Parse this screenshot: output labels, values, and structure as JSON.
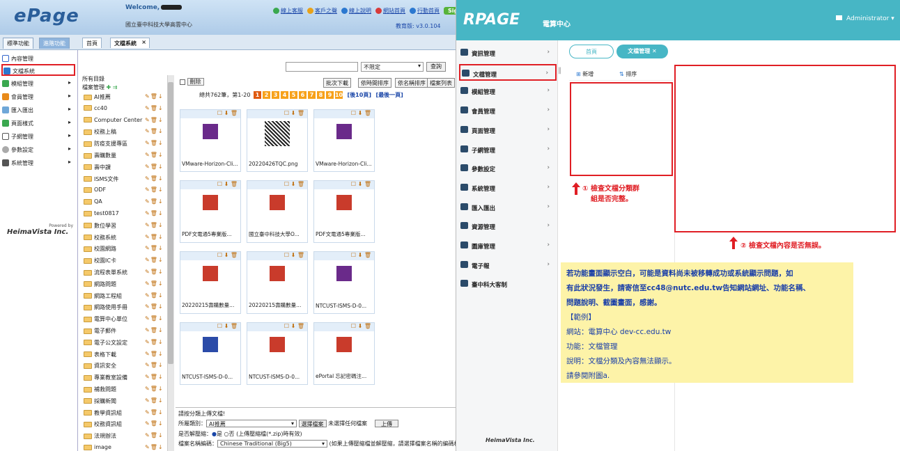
{
  "left": {
    "logo": "ePage",
    "welcome": "Welcome,",
    "school": "國立臺中科技大學高雲中心",
    "toplinks": [
      "線上客服",
      "客戶之聲",
      "線上說明",
      "網站首頁",
      "行動首頁"
    ],
    "signout": "Sign out",
    "version": "教育版: v3.0.104",
    "tabs": [
      "標準功能",
      "進階功能"
    ],
    "inner_tabs": [
      "首頁",
      "文檔系統"
    ],
    "sidebar": [
      "內容管理",
      "文檔系統",
      "模組管理",
      "會員管理",
      "匯入匯出",
      "頁面樣式",
      "子網管理",
      "參數設定",
      "系統管理"
    ],
    "powered_by": "Powered by",
    "heima": "HeimaVista Inc.",
    "tree_header": "所有目錄",
    "tree_root": "檔案管理",
    "tree_items": [
      "AI推薦",
      "cc40",
      "Computer Center",
      "校務上稿",
      "防疫支援專區",
      "壽購數量",
      "壽中課",
      "ISMS文件",
      "ODF",
      "QA",
      "test0817",
      "數位學習",
      "校務系統",
      "校園網路",
      "校園IC卡",
      "流程表單系統",
      "網路問題",
      "網路工程組",
      "網路使用手冊",
      "電算中心單位",
      "電子郵件",
      "電子公文設定",
      "表格下載",
      "資訊安全",
      "專業教室設備",
      "補救問題",
      "採購新聞",
      "教學資訊組",
      "校務資訊組",
      "法規辦法",
      "image"
    ],
    "search_select": "不限定",
    "search_btn": "查詢",
    "delete_label": "刪除",
    "buttons": [
      "批次下載",
      "依時間排序",
      "依名稱排序",
      "檔案列表"
    ],
    "pager_text": "總共762筆，第1-20",
    "pages": [
      "1",
      "2",
      "3",
      "4",
      "5",
      "6",
      "7",
      "8",
      "9",
      "10"
    ],
    "pager_next": "[後10頁]",
    "pager_last": "[最後一頁]",
    "files": [
      "VMware-Horizon-Cli...",
      "20220426TQC.png",
      "VMware-Horizon-Cli...",
      "PDF文電通5專業版...",
      "國立臺中科技大學O...",
      "PDF文電通5專業版...",
      "20220215壽購數量...",
      "20220215壽購數量...",
      "NTCUST-ISMS-D-0...",
      "NTCUST-ISMS-D-0...",
      "NTCUST-ISMS-D-0...",
      "ePortal 忘記密碼注..."
    ],
    "upload": {
      "title": "請按分類上傳文檔!",
      "cat_label": "所屬類別：",
      "cat_value": "AI推薦",
      "choose_btn": "選擇檔案",
      "no_file": "未選擇任何檔案",
      "upload_btn": "上傳",
      "unzip_label": "是否解壓縮：",
      "unzip_yes": "是",
      "unzip_no": "否",
      "unzip_hint": "(上傳壓縮檔(*.zip)時有效)",
      "enc_label": "檔案名稱編碼：",
      "enc_value": "Chinese Traditional (Big5)",
      "enc_hint": "(如果上傳壓縮檔並解壓縮，請選擇檔案名稱的編碼格式)"
    }
  },
  "right": {
    "logo": "RPAGE",
    "sub": "電算中心",
    "admin": "Administrator",
    "sidebar": [
      "資訊管理",
      "文檔管理",
      "模組管理",
      "會員管理",
      "頁面管理",
      "子網管理",
      "參數設定",
      "系統管理",
      "匯入匯出",
      "資源管理",
      "圖庫管理",
      "電子報",
      "臺中科大客制"
    ],
    "tabs": [
      "首頁",
      "文檔管理"
    ],
    "add_btn": "新增",
    "sort_btn": "排序",
    "note1_line1": "① 檢查文檔分類群",
    "note1_line2": "組是否完整。",
    "note2": "② 檢查文檔內容是否無誤。",
    "yellow": {
      "line1": "若功能畫面顯示空白，可能是資料尚未被移轉成功或系統顯示問題，如",
      "line2": "有此狀況發生，請寄信至cc48@nutc.edu.tw告知網站網址、功能名稱、",
      "line3": "問題說明、截圖畫面，感謝。",
      "line4": "【範例】",
      "line5": "網站：電算中心 dev-cc.edu.tw",
      "line6": "功能：文檔管理",
      "line7": "說明：文檔分類及內容無法顯示。",
      "line8": "請參閱附圖a."
    },
    "powered_by": "Powered by",
    "heima": "HeimaVista Inc."
  }
}
